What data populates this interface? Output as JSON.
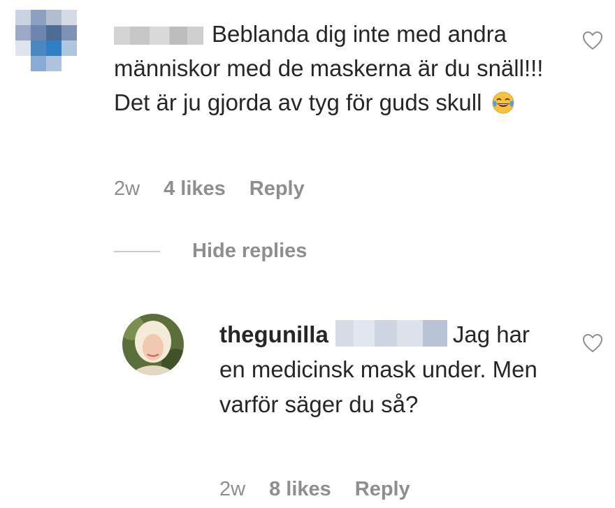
{
  "comment": {
    "text": "Beblanda dig inte med andra människor med de maskerna är du snäll!!! Det är ju gjorda av tyg för guds skull",
    "emoji": "face-with-tears-of-joy",
    "time": "2w",
    "likes": "4 likes",
    "reply_label": "Reply"
  },
  "hide_replies_label": "Hide replies",
  "reply": {
    "username": "thegunilla",
    "text": "Jag har en medicinsk mask under. Men varför säger du så?",
    "time": "2w",
    "likes": "8 likes",
    "reply_label": "Reply"
  },
  "icons": {
    "like": "heart-outline-icon"
  },
  "colors": {
    "text": "#262626",
    "meta": "#8e8e8e",
    "divider": "#c7c7c7"
  }
}
